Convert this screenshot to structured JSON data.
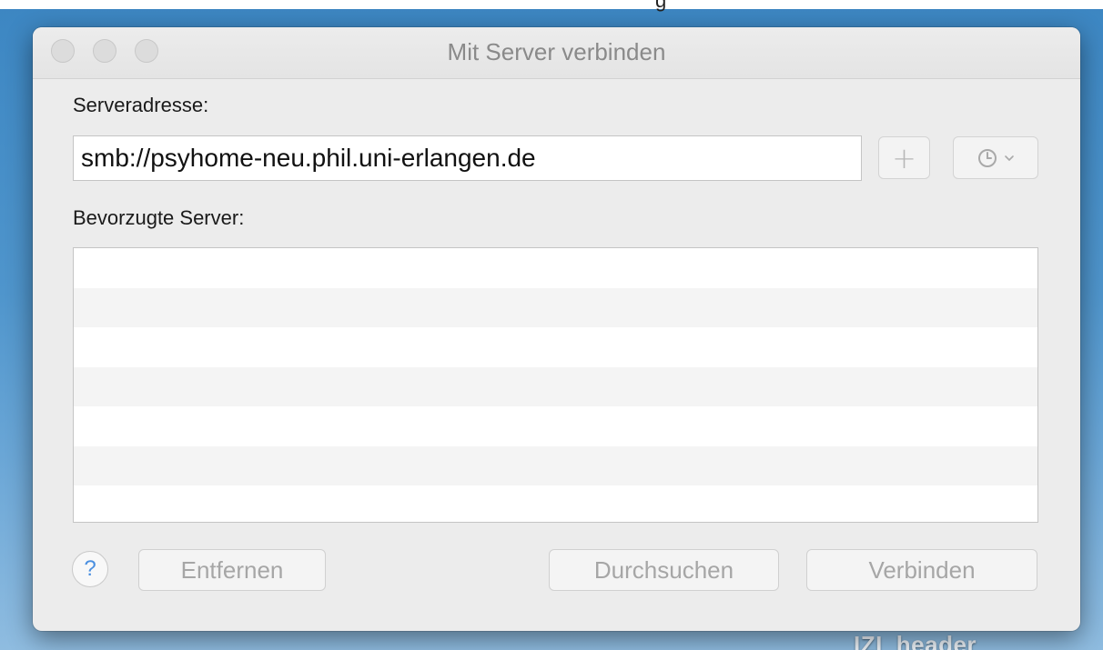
{
  "desktop": {
    "top_text": "g",
    "bottom_label": "IZI_header"
  },
  "window": {
    "title": "Mit Server verbinden"
  },
  "address": {
    "label": "Serveradresse:",
    "value": "smb://psyhome-neu.phil.uni-erlangen.de"
  },
  "toolbar": {
    "add_icon": "plus-icon",
    "recent_icon": "clock-icon",
    "recent_menu_icon": "chevron-down-icon"
  },
  "favorites": {
    "label": "Bevorzugte Server:",
    "items": []
  },
  "buttons": {
    "help": "?",
    "remove": "Entfernen",
    "browse": "Durchsuchen",
    "connect": "Verbinden"
  }
}
